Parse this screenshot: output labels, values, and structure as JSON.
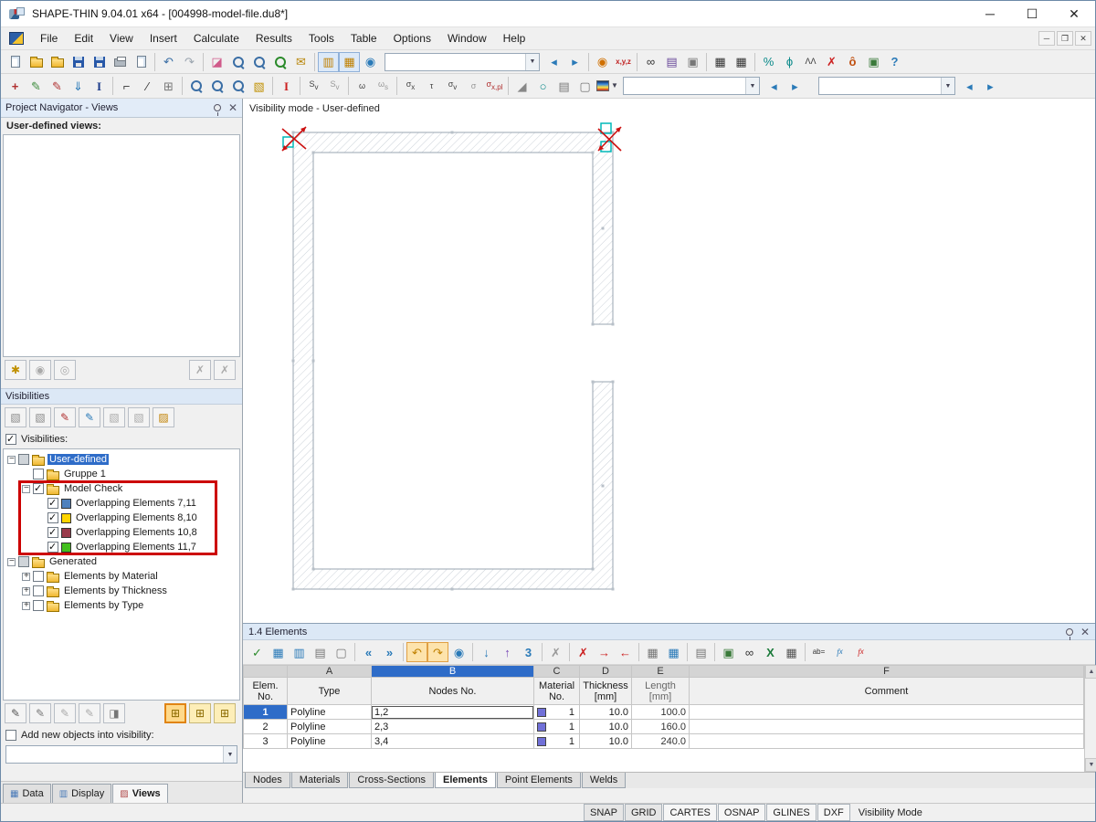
{
  "window": {
    "title": "SHAPE-THIN 9.04.01 x64 - [004998-model-file.du8*]"
  },
  "menu": {
    "items": [
      "File",
      "Edit",
      "View",
      "Insert",
      "Calculate",
      "Results",
      "Tools",
      "Table",
      "Options",
      "Window",
      "Help"
    ]
  },
  "icons": {
    "toolbar_row1": [
      "new-file-icon",
      "open-folder-icon",
      "import-folder-icon",
      "save-icon",
      "save-all-icon",
      "print-icon",
      "print-preview-icon",
      "undo-icon",
      "redo-icon",
      "eraser-icon",
      "zoom-in-icon",
      "zoom-region-icon",
      "zoom-all-icon",
      "send-mail-icon",
      "panels-icon",
      "tables-icon",
      "render-icon",
      "view-combo",
      "back-icon",
      "forward-icon",
      "goto-node-icon",
      "xyz-icon",
      "glasses-icon",
      "frame-view-icon",
      "photo-icon",
      "matrix-icon",
      "matrix2-icon",
      "percent-icon",
      "phi-icon",
      "mirror-icon",
      "delete-icon",
      "info-icon",
      "screenshot-icon",
      "help-select-icon"
    ],
    "toolbar_row2": [
      "snap-node-icon",
      "draw-element-icon",
      "edit-node-icon",
      "insert-nodes-icon",
      "section-icon",
      "polyline-icon",
      "arc-icon",
      "grid-refine-icon",
      "zoom-select-icon",
      "zoom-move-icon",
      "zoom-out-icon",
      "partial-view-icon",
      "isolate-icon",
      "sv1-icon",
      "sv2-icon",
      "omega-icon",
      "omega2-icon",
      "sigma-x-icon",
      "tau-icon",
      "sigma-v-icon",
      "sigma-1-icon",
      "sigma-pl-icon",
      "weld-icon",
      "ellipse-icon",
      "notes-icon",
      "frame-icon",
      "colorscale-icon",
      "panel-combo",
      "cs-back-icon",
      "cs-forward-icon",
      "section-combo",
      "nav2-back-icon",
      "nav2-forward-icon"
    ],
    "visibilities_toolbar": [
      "show-all-icon",
      "show-selection-icon",
      "hide-selection-icon",
      "invert-visibility-icon",
      "save-visibility-icon",
      "load-visibility-icon",
      "visibility-settings-icon"
    ],
    "navigator_bottom_toolbar": [
      "modify-visibility-icon",
      "assign-visibility-icon",
      "remove-visibility-icon",
      "clear-visibility-icon",
      "select-visibility-icon",
      "view-grid-partial-icon",
      "view-grid-group-icon",
      "view-grid-all-icon"
    ],
    "table_toolbar": [
      "set-values-icon",
      "table-add-icon",
      "table-insert-icon",
      "table-copy-icon",
      "table-clear-icon",
      "first-row-icon",
      "last-row-icon",
      "undo-icon",
      "redo-icon",
      "refresh-icon",
      "move-down-icon",
      "move-up-icon",
      "renumber-icon",
      "clear-x-icon",
      "delete-rows-icon",
      "insert-row-icon",
      "remove-row-icon",
      "table-view-icon",
      "table-edit-icon",
      "notes2-icon",
      "picture-icon",
      "glasses2-icon",
      "export-excel-icon",
      "calculator-icon",
      "units-icon",
      "fx-icon",
      "fx-delete-icon"
    ]
  },
  "navigator": {
    "title": "Project Navigator - Views",
    "user_views_label": "User-defined views:",
    "visibilities_section": "Visibilities",
    "visibilities_checkbox_label": "Visibilities:",
    "add_new_label": "Add new objects into visibility:",
    "tabs": [
      {
        "label": "Data"
      },
      {
        "label": "Display"
      },
      {
        "label": "Views"
      }
    ],
    "tree": [
      {
        "label": "User-defined",
        "level": 0,
        "expander": "minus",
        "checkbox": "partial",
        "icon": "folder",
        "selected": true
      },
      {
        "label": "Gruppe 1",
        "level": 1,
        "expander": "none",
        "checkbox": "unchecked",
        "icon": "folder"
      },
      {
        "label": "Model Check",
        "level": 1,
        "expander": "minus",
        "checkbox": "checked",
        "icon": "folder"
      },
      {
        "label": "Overlapping Elements 7,11",
        "level": 2,
        "expander": "none",
        "checkbox": "checked",
        "icon": "swatch",
        "color": "#4f81bd"
      },
      {
        "label": "Overlapping Elements 8,10",
        "level": 2,
        "expander": "none",
        "checkbox": "checked",
        "icon": "swatch",
        "color": "#ffd500"
      },
      {
        "label": "Overlapping Elements 10,8",
        "level": 2,
        "expander": "none",
        "checkbox": "checked",
        "icon": "swatch",
        "color": "#993a4b"
      },
      {
        "label": "Overlapping Elements 11,7",
        "level": 2,
        "expander": "none",
        "checkbox": "checked",
        "icon": "swatch",
        "color": "#43bf1e"
      },
      {
        "label": "Generated",
        "level": 0,
        "expander": "minus",
        "checkbox": "partial",
        "icon": "folder"
      },
      {
        "label": "Elements by Material",
        "level": 1,
        "expander": "plus",
        "checkbox": "unchecked",
        "icon": "folder"
      },
      {
        "label": "Elements by Thickness",
        "level": 1,
        "expander": "plus",
        "checkbox": "unchecked",
        "icon": "folder"
      },
      {
        "label": "Elements by Type",
        "level": 1,
        "expander": "plus",
        "checkbox": "unchecked",
        "icon": "folder"
      }
    ]
  },
  "canvas": {
    "mode_label": "Visibility mode - User-defined"
  },
  "elements_panel": {
    "title": "1.4 Elements",
    "column_letters": [
      "A",
      "B",
      "C",
      "D",
      "E",
      "F"
    ],
    "corner_header": {
      "line1": "Elem.",
      "line2": "No."
    },
    "columns": [
      {
        "letter": "A",
        "name": "Type"
      },
      {
        "letter": "B",
        "name": "Nodes No."
      },
      {
        "letter": "C",
        "name": "Material",
        "sub": "No."
      },
      {
        "letter": "D",
        "name": "Thickness",
        "sub": "[mm]"
      },
      {
        "letter": "E",
        "name": "Length",
        "sub": "[mm]"
      },
      {
        "letter": "F",
        "name": "Comment"
      }
    ],
    "material_color": "#7070d8",
    "rows": [
      {
        "no": "1",
        "type": "Polyline",
        "nodes": "1,2",
        "material": "1",
        "thickness": "10.0",
        "length": "100.0",
        "comment": ""
      },
      {
        "no": "2",
        "type": "Polyline",
        "nodes": "2,3",
        "material": "1",
        "thickness": "10.0",
        "length": "160.0",
        "comment": ""
      },
      {
        "no": "3",
        "type": "Polyline",
        "nodes": "3,4",
        "material": "1",
        "thickness": "10.0",
        "length": "240.0",
        "comment": ""
      }
    ],
    "tabs": [
      "Nodes",
      "Materials",
      "Cross-Sections",
      "Elements",
      "Point Elements",
      "Welds"
    ],
    "active_tab": "Elements"
  },
  "statusbar": {
    "toggles": [
      "SNAP",
      "GRID",
      "CARTES",
      "OSNAP",
      "GLINES",
      "DXF"
    ],
    "mode_text": "Visibility Mode"
  }
}
